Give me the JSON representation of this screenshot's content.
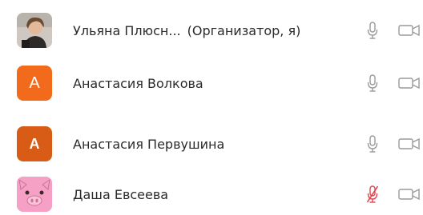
{
  "participants": [
    {
      "name": "Ульяна Плюсн...",
      "role": "(Организатор, я)",
      "avatar": {
        "type": "photo",
        "letter": ""
      },
      "mic": "unmuted",
      "camera": "off"
    },
    {
      "name": "Анастасия Волкова",
      "role": "",
      "avatar": {
        "type": "letter",
        "letter": "A",
        "color": "#f26b1d"
      },
      "mic": "unmuted",
      "camera": "off"
    },
    {
      "name": "Анастасия Первушина",
      "role": "",
      "avatar": {
        "type": "letter",
        "letter": "A",
        "color": "#d95c16"
      },
      "mic": "unmuted",
      "camera": "off"
    },
    {
      "name": "Даша Евсеева",
      "role": "",
      "avatar": {
        "type": "image-pig",
        "letter": ""
      },
      "mic": "muted",
      "camera": "off"
    }
  ],
  "colors": {
    "icon_gray": "#9a9a9a",
    "muted_red": "#e0464f",
    "avatar_orange": "#f26b1d",
    "avatar_orange_dark": "#d95c16"
  }
}
